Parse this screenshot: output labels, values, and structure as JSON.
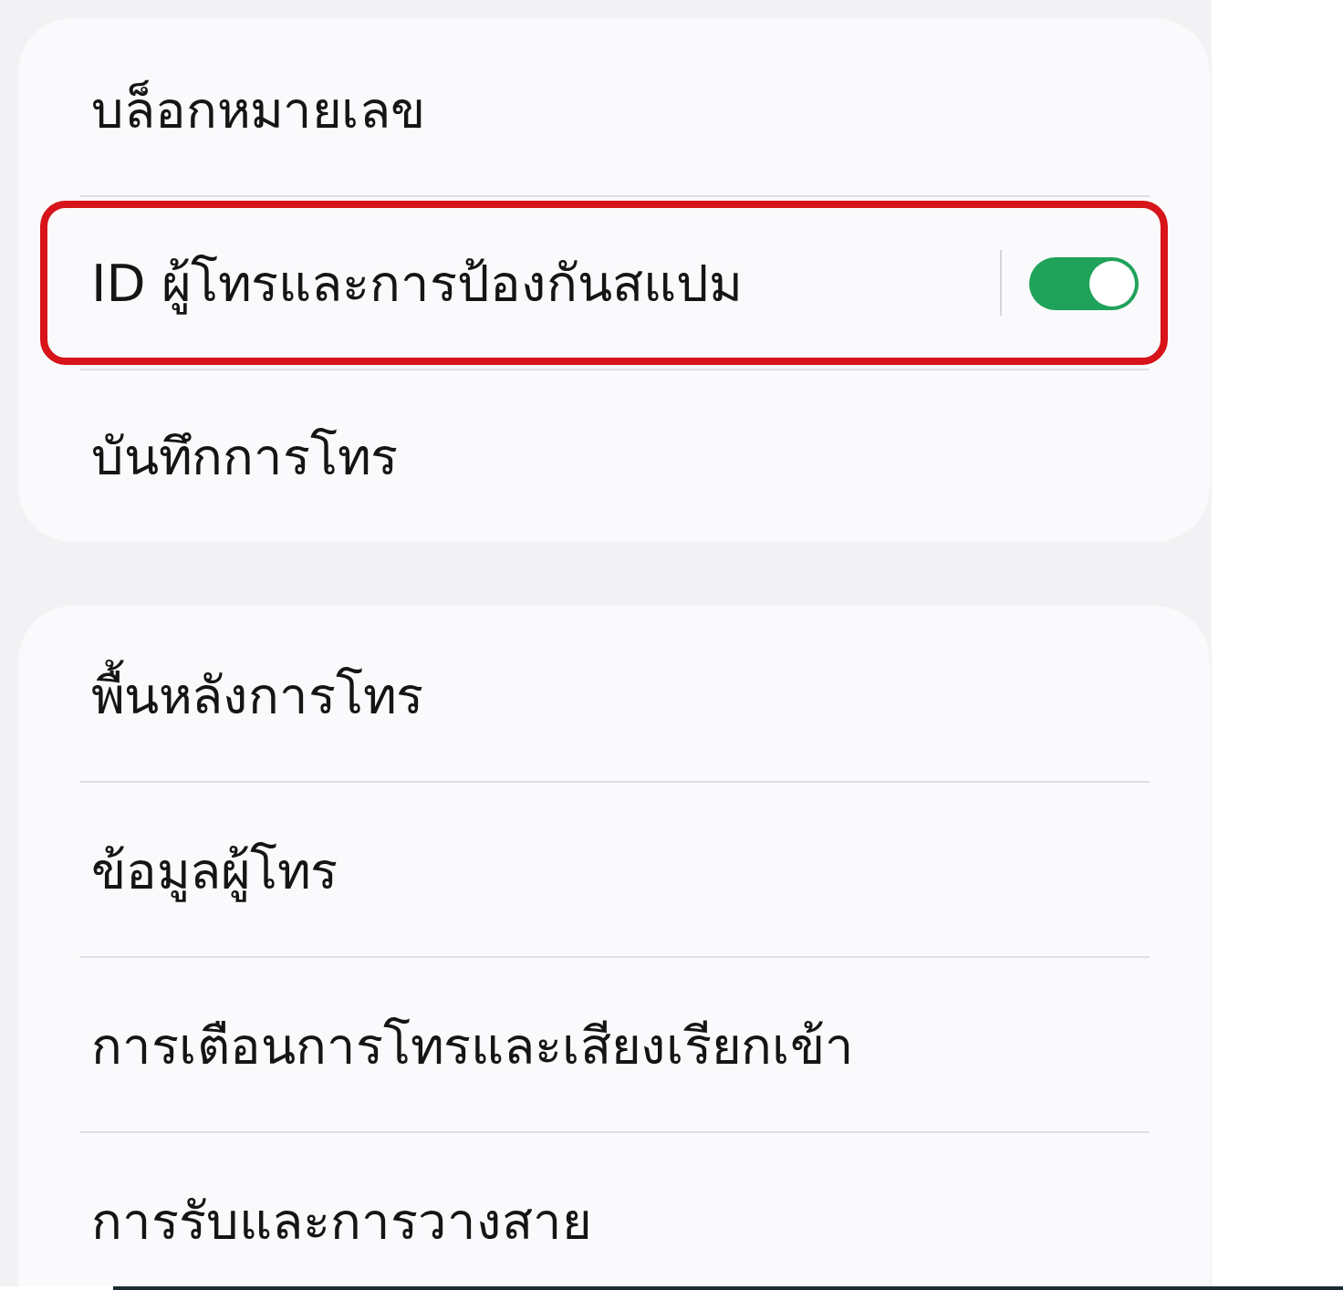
{
  "cards": [
    {
      "items": [
        {
          "kind": "link",
          "label": "บล็อกหมายเลข",
          "highlighted": false
        },
        {
          "kind": "toggle",
          "label": "ID ผู้โทรและการป้องกันสแปม",
          "on": true,
          "highlighted": true
        },
        {
          "kind": "link",
          "label": "บันทึกการโทร",
          "highlighted": false
        }
      ]
    },
    {
      "items": [
        {
          "kind": "link",
          "label": "พื้นหลังการโทร",
          "highlighted": false
        },
        {
          "kind": "link",
          "label": "ข้อมูลผู้โทร",
          "highlighted": false
        },
        {
          "kind": "link",
          "label": "การเตือนการโทรและเสียงเรียกเข้า",
          "highlighted": false
        },
        {
          "kind": "link",
          "label": "การรับและการวางสาย",
          "highlighted": false
        }
      ]
    }
  ]
}
